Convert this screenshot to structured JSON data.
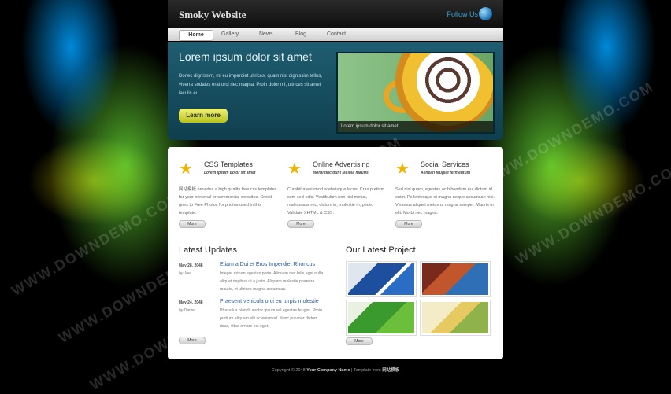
{
  "header": {
    "logo": "Smoky Website",
    "follow": "Follow Us"
  },
  "nav": {
    "items": [
      "Home",
      "Gallery",
      "News",
      "Blog",
      "Contact"
    ]
  },
  "hero": {
    "title": "Lorem ipsum dolor sit amet",
    "text": "Donec dignissim, mi eu imperdiet ultrices, quam nisi dignissim tellus, viverra sodales erat orci nec magna. Proin dolor mi, ultrices sit amet iaculis eu.",
    "button": "Learn more",
    "caption": "Lorem ipsum dolor sit amet"
  },
  "features": [
    {
      "title": "CSS Templates",
      "sub": "Lorem ipsum dolor sit amet",
      "text": "网站模板 provides a high quality free css templates for your personal or commercial websites. Credit goes to Free Photos for photos used in this template.",
      "more": "More"
    },
    {
      "title": "Online Advertising",
      "sub": "Morbi tincidunt lacinia mauris",
      "text": "Curabitur euismod scelerisque lacus. Cras pretium sem sed odio. Vestibulum non nisl metus, malesuada nec, dictum in, molestie in, pede. Validate XHTML & CSS.",
      "more": "More"
    },
    {
      "title": "Social Services",
      "sub": "Aenean feugiat fermentum",
      "text": "Sed nisi quam, egestas ac bibendum eu, dictum id enim. Pellentesque et magna neque accumsan nisi. Vivamus aliquet metus ut magna semper. Mauris in elit. Morbi nec magna.",
      "more": "More"
    }
  ],
  "updates": {
    "heading": "Latest Updates",
    "items": [
      {
        "date": "May 28, 2048",
        "by": "by Joel",
        "title": "Etiam a Dui et Eros Imperdiet Rhoncus",
        "body": "Integer rutrum egestas porta. Aliquam nec felis eget nulla aliquet dapibus ut a justo. Aliquam molestie pharetra mauris, et ultrices magna accumsan."
      },
      {
        "date": "May 24, 2048",
        "by": "by Daniel",
        "title": "Praesent vehicula orci eu turpis molestie",
        "body": "Phasellus blandit auctor ipsum vel egestas feugiat. Proin pretium aliquam elit ac euismod. Nunc pulvinar dictum risus, vitae ornare est eget."
      }
    ],
    "more": "More"
  },
  "projects": {
    "heading": "Our Latest Project",
    "more": "More"
  },
  "footer": {
    "prefix": "Copyright © 2048 ",
    "company": "Your Company Name",
    "suffix": " | Template from ",
    "source": "网站模板"
  },
  "watermark": "WWW.DOWNDEMO.COM",
  "colors": {
    "accent_teal": "#1f5d70",
    "button_yellow": "#d6dd3a",
    "link_blue": "#2a5a9a"
  }
}
